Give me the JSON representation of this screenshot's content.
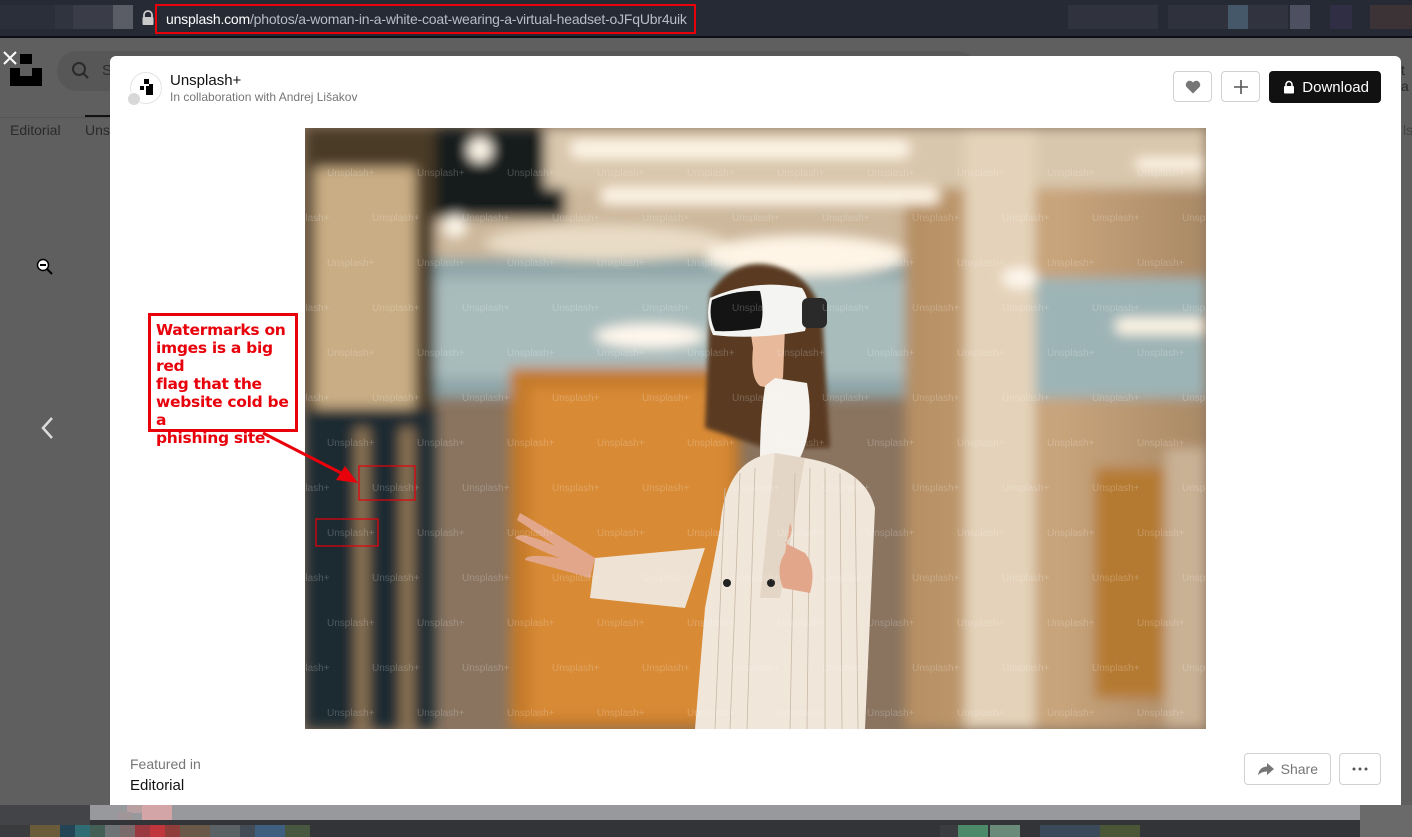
{
  "browser": {
    "url_host": "unsplash.com",
    "url_path": "/photos/a-woman-in-a-white-coat-wearing-a-virtual-headset-oJFqUbr4uik"
  },
  "background_page": {
    "search_placeholder_partial": "S",
    "tabs": [
      "Editorial",
      "Uns"
    ],
    "active_tab_index": 1,
    "right_partial_text": "t a",
    "right_partial_text2": "ls"
  },
  "modal": {
    "author": {
      "name": "Unsplash+",
      "subtitle": "In collaboration with Andrej Lišakov"
    },
    "actions": {
      "like_icon": "heart-icon",
      "add_icon": "plus-icon",
      "download_label": "Download",
      "download_icon": "lock-icon"
    },
    "photo": {
      "alt": "A woman in a white coat wearing a virtual headset",
      "watermark_text": "Unsplash+"
    },
    "featured": {
      "label": "Featured in",
      "value": "Editorial"
    },
    "bottom_actions": {
      "share_label": "Share",
      "share_icon": "share-arrow-icon",
      "more_icon": "more-horizontal-icon"
    }
  },
  "annotation": {
    "text_lines": [
      "Watermarks on",
      "imges is a big red",
      "flag that the",
      "website cold be a",
      "phishing site."
    ],
    "color": "#e8000b"
  },
  "navigation": {
    "close_icon": "close-icon",
    "prev_icon": "chevron-left-icon"
  }
}
